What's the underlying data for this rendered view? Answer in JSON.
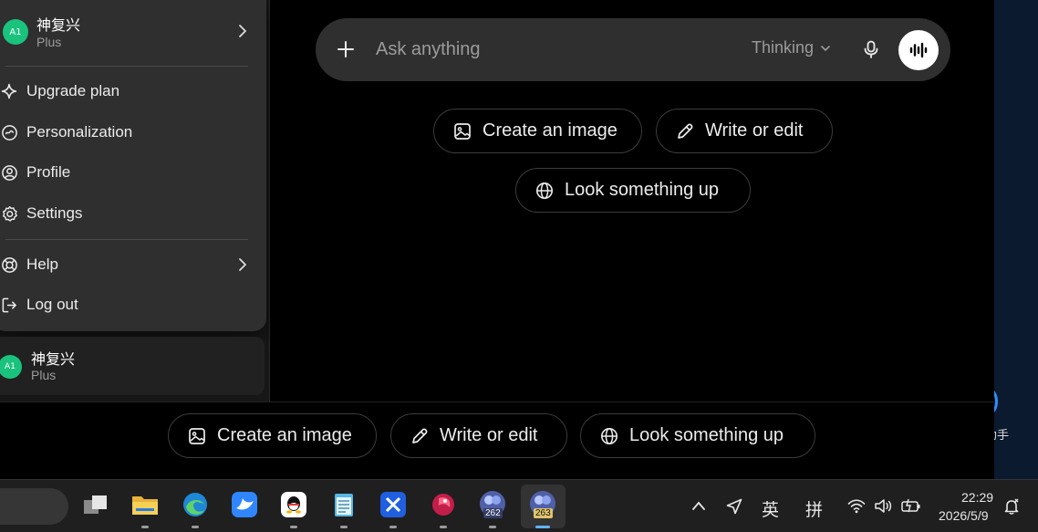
{
  "account_menu": {
    "avatar_initials": "A1",
    "user_name": "神复兴",
    "plan": "Plus",
    "items": [
      {
        "label": "Upgrade plan",
        "icon": "sparkle-icon"
      },
      {
        "label": "Personalization",
        "icon": "personalization-icon"
      },
      {
        "label": "Profile",
        "icon": "user-circle-icon"
      },
      {
        "label": "Settings",
        "icon": "gear-icon"
      },
      {
        "label": "Help",
        "icon": "lifebuoy-icon"
      },
      {
        "label": "Log out",
        "icon": "logout-icon"
      }
    ]
  },
  "sidebar_profile": {
    "avatar_initials": "A1",
    "user_name": "神复兴",
    "plan": "Plus"
  },
  "composer": {
    "placeholder": "Ask anything",
    "model_mode": "Thinking"
  },
  "suggestions_top": [
    "Create an image",
    "Write or edit",
    "Look something up"
  ],
  "suggestions_bottom": [
    "Create an image",
    "Write or edit",
    "Look something up"
  ],
  "desktop": {
    "shortcut_label": "助手"
  },
  "taskbar": {
    "badges": [
      "262",
      "263"
    ],
    "tray_ime_lang": "英",
    "tray_ime_mode": "拼",
    "time": "22:29",
    "date": "2026/5/9"
  },
  "colors": {
    "background": "#000000",
    "menu": "#2f2f2f",
    "avatar": "#19c37d",
    "taskbar": "#1f1f1f"
  }
}
